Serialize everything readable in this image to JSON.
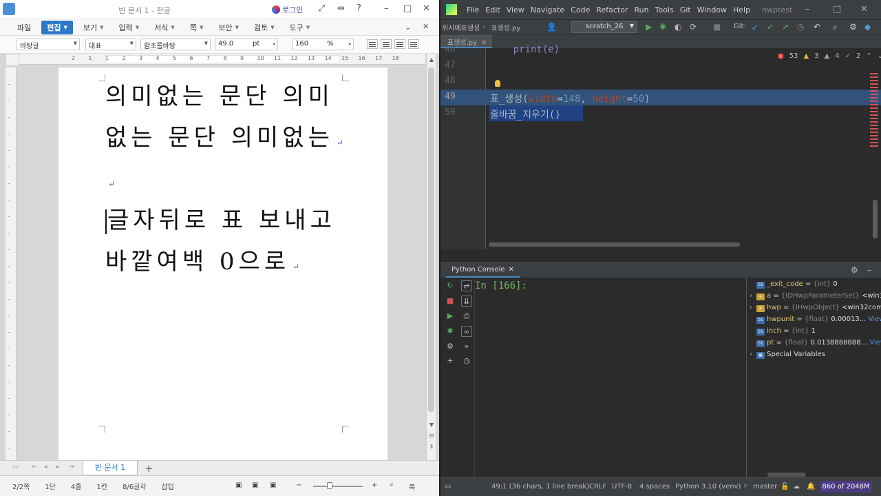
{
  "hwp": {
    "title": "빈 문서 1 - 한글",
    "login": "로그인",
    "menu": [
      "파일",
      "편집",
      "보기",
      "입력",
      "서식",
      "쪽",
      "보안",
      "검토",
      "도구"
    ],
    "format": {
      "style": "바탕글",
      "lang": "대표",
      "font": "함초롬바탕",
      "size": "49.0",
      "size_unit": "pt",
      "line_spacing": "160",
      "line_unit": "%"
    },
    "ruler_nums": [
      "2",
      "1",
      "1",
      "2",
      "3",
      "4",
      "5",
      "6",
      "7",
      "8",
      "9",
      "10",
      "11",
      "12",
      "13",
      "14",
      "15",
      "16",
      "17",
      "18"
    ],
    "doc_lines": [
      "의미없는 문단 의미",
      "없는 문단 의미없는",
      "",
      "글자뒤로 표 보내고",
      "바깥여백 0으로"
    ],
    "tab_name": "빈 문서 1",
    "status": {
      "page": "2/2쪽",
      "section": "1단",
      "line": "4줄",
      "col": "1칸",
      "chars": "8/6글자",
      "mode": "삽입"
    }
  },
  "pycharm": {
    "menu": [
      "File",
      "Edit",
      "View",
      "Navigate",
      "Code",
      "Refactor",
      "Run",
      "Tools",
      "Git",
      "Window",
      "Help"
    ],
    "project": "hwptest",
    "breadcrumb": "위시에표생성",
    "nav_file": "표생성.py",
    "run_config": "scratch_26",
    "git_label": "Git:",
    "file_tab": "표생성.py",
    "inspections": {
      "errors": "53",
      "warnings": "3",
      "weak": "4",
      "ok": "2"
    },
    "lines": [
      {
        "n": "46",
        "text": "    print(e)"
      },
      {
        "n": "47",
        "text": ""
      },
      {
        "n": "48",
        "text": ""
      },
      {
        "n": "49",
        "fn": "표_생성(",
        "p1": "width",
        "v1": "148",
        "p2": "height",
        "v2": "50",
        "end": ")"
      },
      {
        "n": "50",
        "text": "줄바꿈_지우기()"
      }
    ],
    "console_tab": "Python Console",
    "prompt": "In [166]:",
    "variables": [
      {
        "name": "_exit_code",
        "type": "{int}",
        "value": "0",
        "kind": "01"
      },
      {
        "name": "a",
        "type": "{IDHwpParameterSet}",
        "value": "<win3",
        "kind": "obj"
      },
      {
        "name": "hwp",
        "type": "{IHwpObject}",
        "value": "<win32com",
        "kind": "obj"
      },
      {
        "name": "hwpunit",
        "type": "{float}",
        "value": "0.00013...",
        "kind": "01",
        "link": "View"
      },
      {
        "name": "inch",
        "type": "{int}",
        "value": "1",
        "kind": "01"
      },
      {
        "name": "pt",
        "type": "{float}",
        "value": "0.0138888888...",
        "kind": "01",
        "link": "View"
      }
    ],
    "special": "Special Variables",
    "status": {
      "pos": "49:1 (36 chars, 1 line break)",
      "eol": "CRLF",
      "enc": "UTF-8",
      "indent": "4 spaces",
      "interp": "Python 3.10 (venv)",
      "branch": "master",
      "mem": "860 of 2048M"
    }
  }
}
